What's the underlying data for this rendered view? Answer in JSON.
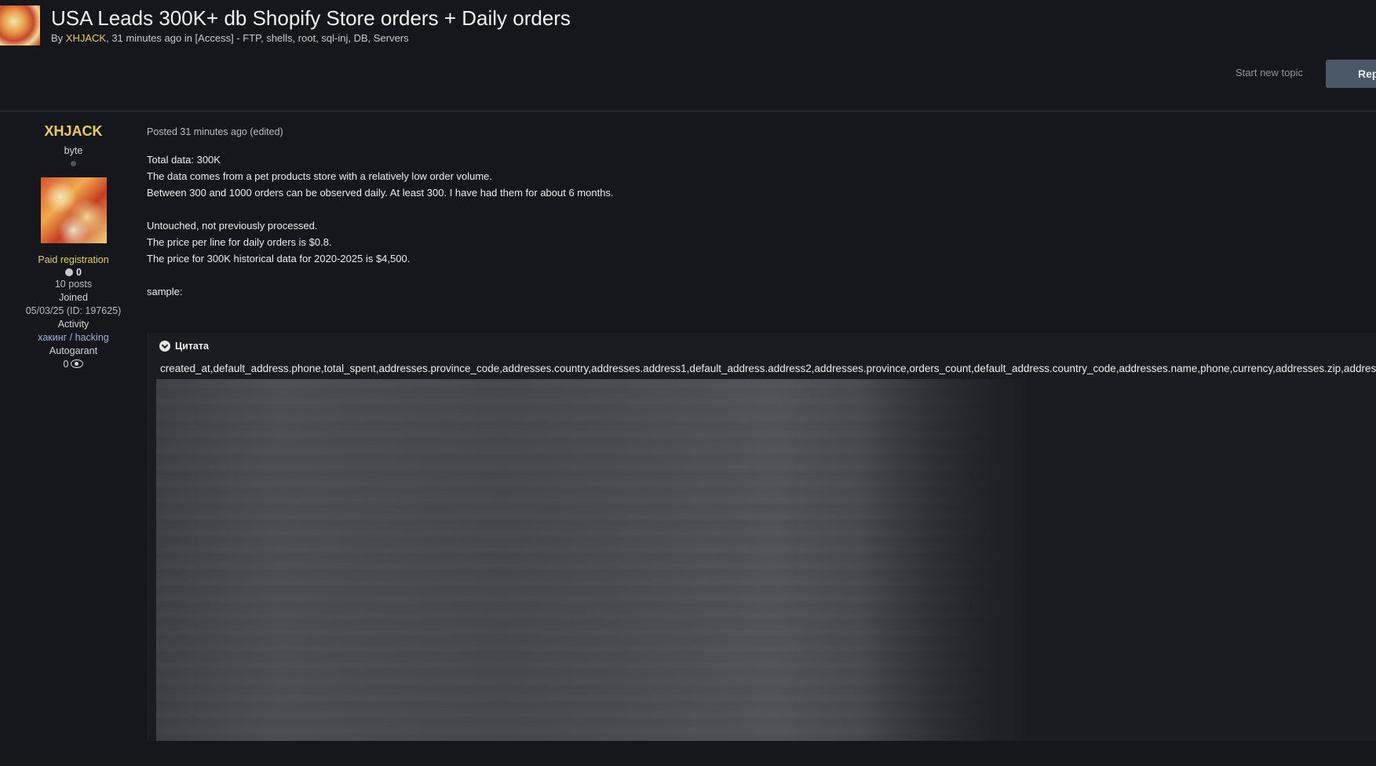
{
  "topic": {
    "title": "USA Leads 300K+ db Shopify Store orders + Daily orders",
    "meta_prefix": "By ",
    "author": "XHJACK",
    "meta_suffix": ", 31 minutes ago in [Access] - FTP, shells, root, sql-inj, DB, Servers"
  },
  "actions": {
    "start_new_topic": "Start new topic",
    "reply": "Reply"
  },
  "author_panel": {
    "name": "XHJACK",
    "rank": "byte",
    "group": "Paid registration",
    "reputation": "0",
    "posts": "10 posts",
    "joined_label": "Joined",
    "joined_value": "05/03/25 (ID: 197625)",
    "activity_label": "Activity",
    "activity_value": "хакинг / hacking",
    "autogarant_label": "Autogarant",
    "autogarant_value": "0"
  },
  "post": {
    "posted": "Posted 31 minutes ago (edited)",
    "lines": [
      "Total data: 300K",
      "The data comes from a pet products store with a relatively low order volume.",
      "Between 300 and 1000 orders can be observed daily. At least 300. I have had them for about 6 months.",
      "Untouched, not previously processed.",
      "The price per line for daily orders is $0.8.",
      "The price for 300K historical data for 2020-2025 is $4,500.",
      "sample:"
    ]
  },
  "quote": {
    "label": "Цитата",
    "csv_header": "created_at,default_address.phone,total_spent,addresses.province_code,addresses.country,addresses.address1,default_address.address2,addresses.province,orders_count,default_address.country_code,addresses.name,phone,currency,addresses.zip,addresses.city,email"
  },
  "colors": {
    "background": "#15171c",
    "accent_yellow": "#e6cf5a",
    "reply_button": "#4b5867"
  }
}
